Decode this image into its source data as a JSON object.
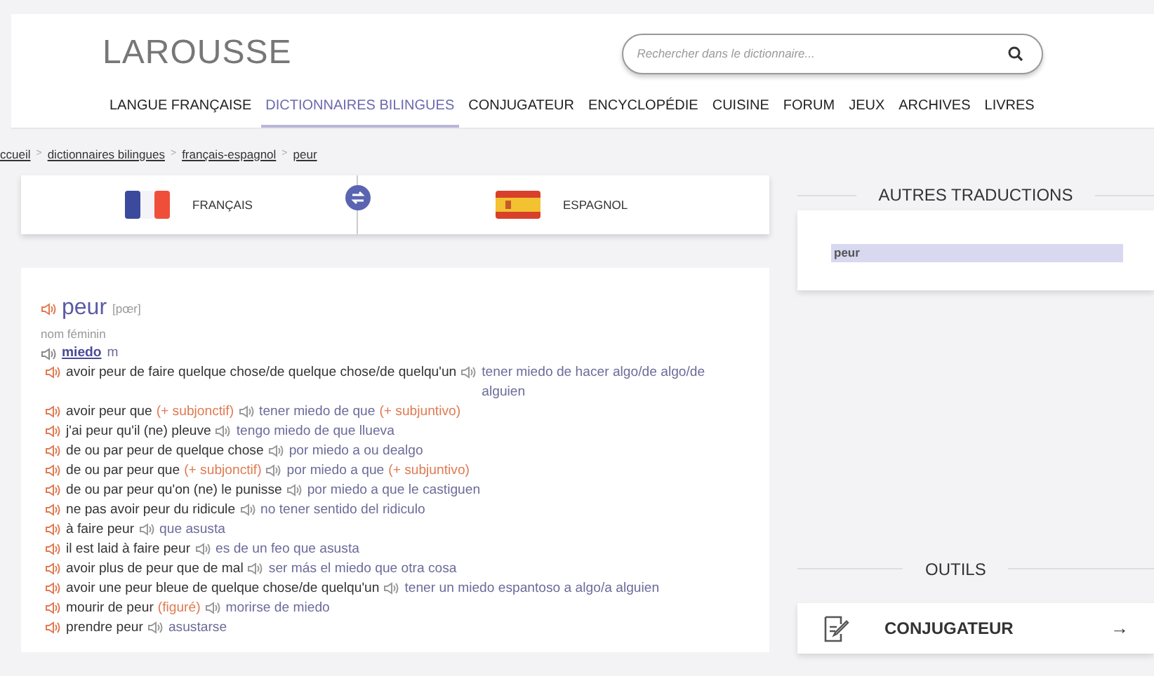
{
  "header": {
    "logo": "LAROUSSE",
    "search": {
      "placeholder": "Rechercher dans le dictionnaire..."
    },
    "nav": [
      {
        "label": "LANGUE FRANÇAISE",
        "selected": false
      },
      {
        "label": "DICTIONNAIRES BILINGUES",
        "selected": true
      },
      {
        "label": "CONJUGATEUR",
        "selected": false
      },
      {
        "label": "ENCYCLOPÉDIE",
        "selected": false
      },
      {
        "label": "CUISINE",
        "selected": false
      },
      {
        "label": "FORUM",
        "selected": false
      },
      {
        "label": "JEUX",
        "selected": false
      },
      {
        "label": "ARCHIVES",
        "selected": false
      },
      {
        "label": "LIVRES",
        "selected": false
      }
    ]
  },
  "breadcrumb": [
    {
      "kind": "link",
      "text": "ccueil"
    },
    {
      "kind": "sep",
      "text": ">"
    },
    {
      "kind": "link",
      "text": "dictionnaires bilingues"
    },
    {
      "kind": "sep",
      "text": ">"
    },
    {
      "kind": "link",
      "text": "français-espagnol"
    },
    {
      "kind": "sep",
      "text": ">"
    },
    {
      "kind": "link",
      "text": "peur"
    }
  ],
  "languages": {
    "source": {
      "label": "FRANÇAIS"
    },
    "target": {
      "label": "ESPAGNOL"
    }
  },
  "entry": {
    "headword": "peur",
    "phonetic": "[pœr]",
    "pos": "nom féminin",
    "translation": "miedo",
    "gender": "m",
    "lines": [
      [
        {
          "kind": "fr",
          "text": "avoir peur de faire quelque chose/de quelque chose/de quelqu'un"
        },
        {
          "kind": "es",
          "text": "tener miedo de hacer algo/de algo/de alguien"
        }
      ],
      [
        {
          "kind": "fr",
          "text": "avoir peur que"
        },
        {
          "kind": "note",
          "text": "(+ subjonctif)"
        },
        {
          "kind": "es",
          "text": "tener miedo de que"
        },
        {
          "kind": "note",
          "text": "(+ subjuntivo)"
        }
      ],
      [
        {
          "kind": "fr",
          "text": "j'ai peur qu'il (ne) pleuve"
        },
        {
          "kind": "es",
          "text": "tengo miedo de que llueva"
        }
      ],
      [
        {
          "kind": "fr",
          "text": "de ou par peur de quelque chose"
        },
        {
          "kind": "es",
          "text": "por miedo a ou dealgo"
        }
      ],
      [
        {
          "kind": "fr",
          "text": "de ou par peur que"
        },
        {
          "kind": "note",
          "text": "(+ subjonctif)"
        },
        {
          "kind": "es",
          "text": "por miedo a que"
        },
        {
          "kind": "note",
          "text": "(+ subjuntivo)"
        }
      ],
      [
        {
          "kind": "fr",
          "text": "de ou par peur qu'on (ne) le punisse"
        },
        {
          "kind": "es",
          "text": "por miedo a que le castiguen"
        }
      ],
      [
        {
          "kind": "fr",
          "text": "ne pas avoir peur du ridicule"
        },
        {
          "kind": "es",
          "text": "no tener sentido del ridiculo"
        }
      ],
      [
        {
          "kind": "fr",
          "text": "à faire peur"
        },
        {
          "kind": "es",
          "text": "que asusta"
        }
      ],
      [
        {
          "kind": "fr",
          "text": "il est laid à faire peur"
        },
        {
          "kind": "es",
          "text": "es de un feo que asusta"
        }
      ],
      [
        {
          "kind": "fr",
          "text": "avoir plus de peur que de mal"
        },
        {
          "kind": "es",
          "text": "ser más el miedo que otra cosa"
        }
      ],
      [
        {
          "kind": "fr",
          "text": "avoir une peur bleue de quelque chose/de quelqu'un"
        },
        {
          "kind": "es",
          "text": "tener un miedo espantoso a algo/a alguien"
        }
      ],
      [
        {
          "kind": "fr",
          "text": "mourir de peur"
        },
        {
          "kind": "note",
          "text": "(figuré)"
        },
        {
          "kind": "es",
          "text": "morirse de miedo"
        }
      ],
      [
        {
          "kind": "fr",
          "text": "prendre peur"
        },
        {
          "kind": "es",
          "text": "asustarse"
        }
      ]
    ]
  },
  "sidebar": {
    "other_translations": {
      "title": "AUTRES TRADUCTIONS",
      "items": [
        {
          "label": "peur",
          "selected": true
        }
      ]
    },
    "tools": {
      "title": "OUTILS",
      "items": [
        {
          "label": "CONJUGATEUR",
          "arrow": "→"
        }
      ]
    }
  }
}
